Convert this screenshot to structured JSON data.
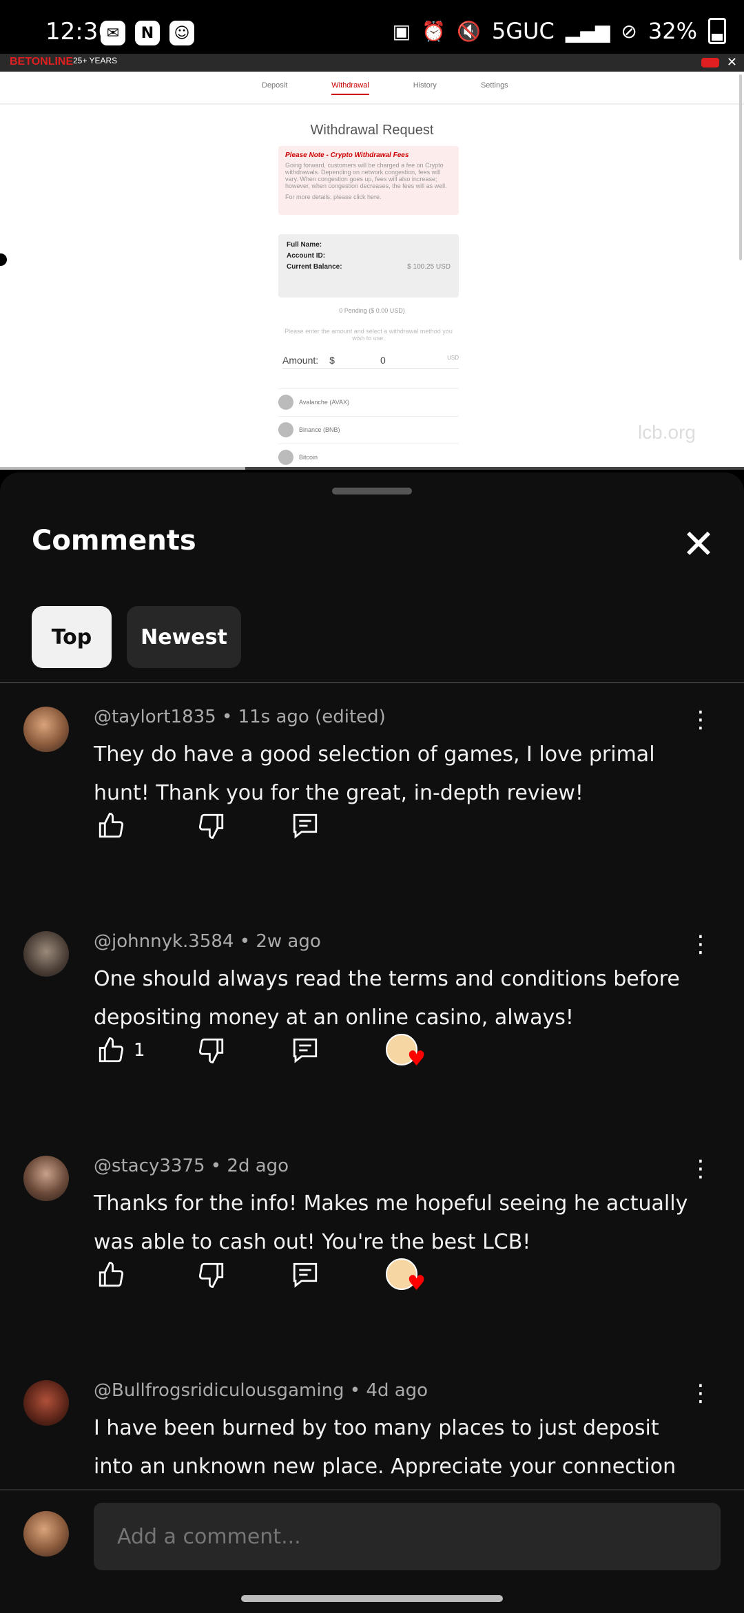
{
  "status_bar": {
    "time": "12:36",
    "network": "5GUC",
    "battery": "32%"
  },
  "video": {
    "logo": "BETONLINE",
    "badge": "25+ YEARS",
    "tabs": [
      "Deposit",
      "Withdrawal",
      "History",
      "Settings"
    ],
    "active_tab": "Withdrawal",
    "title": "Withdrawal Request",
    "note_title": "Please Note - Crypto Withdrawal Fees",
    "note_body": "Going forward, customers will be charged a fee on Crypto withdrawals. Depending on network congestion, fees will vary. When congestion goes up, fees will also increase; however, when congestion decreases, the fees will as well.",
    "note_more": "For more details, please click here.",
    "full_name_label": "Full Name:",
    "account_id_label": "Account ID:",
    "balance_label": "Current Balance:",
    "balance_value": "$ 100.25 USD",
    "pending": "0 Pending ($ 0.00 USD)",
    "prompt": "Please enter the amount and select a withdrawal method you wish to use.",
    "amount_label": "Amount:",
    "currency_symbol": "$",
    "amount_value": "0",
    "amount_unit": "USD",
    "methods": [
      "Avalanche (AVAX)",
      "Binance (BNB)",
      "Bitcoin"
    ],
    "watermark": "lcb.org",
    "progress": 0.33
  },
  "comments_sheet": {
    "title": "Comments",
    "filters": [
      "Top",
      "Newest"
    ],
    "active_filter": "Top",
    "comments": [
      {
        "handle": "@taylort1835",
        "age": "11s ago (edited)",
        "text": "They do have a good selection of games, I love primal hunt! Thank you for the great, in-depth review!",
        "likes": "",
        "creator_heart": false
      },
      {
        "handle": "@johnnyk.3584",
        "age": "2w ago",
        "text": "One should always read the terms and conditions before depositing money at an online casino, always!",
        "likes": "1",
        "creator_heart": true
      },
      {
        "handle": "@stacy3375",
        "age": "2d ago",
        "text": "Thanks for the info! Makes me hopeful seeing he actually was able to cash out! You're the best LCB!",
        "likes": "",
        "creator_heart": true
      },
      {
        "handle": "@Bullfrogsridiculousgaming",
        "age": "4d ago",
        "text": "I have been burned by too many places to just deposit into an unknown new place. Appreciate your connection with",
        "likes": "",
        "creator_heart": false
      }
    ],
    "meta_separator": "•",
    "composer_placeholder": "Add a comment..."
  },
  "colors": {
    "sheet_bg": "#0f0f0f",
    "chip_active": "#f1f1f1",
    "chip_inactive": "#272727",
    "heart": "#ff0000",
    "brand_red": "#e02020"
  }
}
